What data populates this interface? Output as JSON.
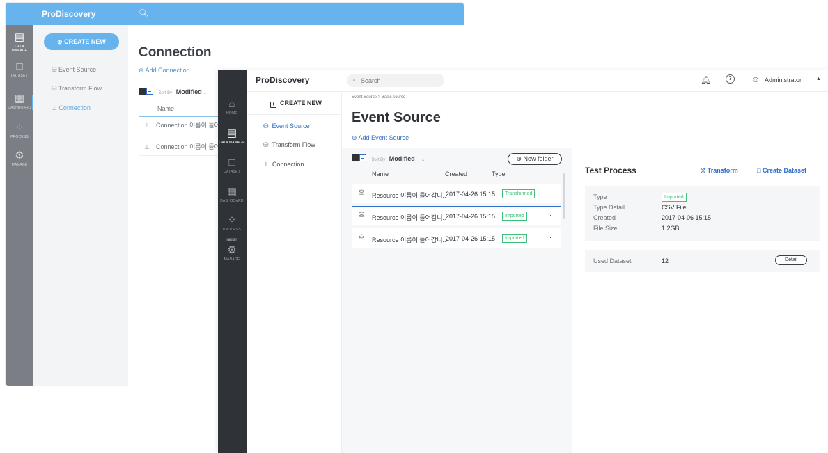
{
  "back_window": {
    "logo": "ProDiscovery",
    "rail": [
      {
        "label": "DATA\nMANAGE",
        "icon": "data-manage-icon"
      },
      {
        "label": "DATASET",
        "icon": "dataset-icon"
      },
      {
        "label": "DASHBOARD",
        "icon": "dashboard-icon"
      },
      {
        "label": "PROCESS",
        "icon": "process-icon"
      },
      {
        "label": "MANAGE",
        "icon": "gear-icon"
      }
    ],
    "create_new": "CREATE NEW",
    "menu": [
      "Event Source",
      "Transform Flow",
      "Connection"
    ],
    "title": "Connection",
    "add_link": "Add Connection",
    "sort_by_label": "Sort By",
    "sort_value": "Modified",
    "name_col": "Name",
    "rows": [
      "Connection 이름이 들어",
      "Connection 이름이 들어"
    ]
  },
  "front_window": {
    "logo": "ProDiscovery",
    "search_placeholder": "Search",
    "user": "Administrator",
    "rail": {
      "home": "HOME",
      "data_manage": "DATA MANAGE",
      "dataset": "DATASET",
      "dashboard": "DASHBOARD",
      "process": "PROCESS",
      "beta": "BETA",
      "manage": "MANAGE"
    },
    "create_new": "CREATE NEW",
    "menu": {
      "event_source": "Event Source",
      "transform_flow": "Transform Flow",
      "connection": "Connection"
    },
    "breadcrumb": "Event Source > Basic source",
    "title": "Event Source",
    "add_link": "Add Event Source",
    "sort_by_label": "Sort By",
    "sort_value": "Modified",
    "new_folder": "New folder",
    "columns": {
      "name": "Name",
      "created": "Created",
      "type": "Type"
    },
    "rows": [
      {
        "name": "Resource 이름이 들어갑니..",
        "created": "2017-04-26 15:15",
        "type": "Transformed",
        "more": "···"
      },
      {
        "name": "Resource 이름이 들어갑니..",
        "created": "2017-04-26 15:15",
        "type": "Imported",
        "more": "···"
      },
      {
        "name": "Resource 이름이 들어갑니..",
        "created": "2017-04-26 15:15",
        "type": "Imported",
        "more": "···"
      }
    ],
    "detail": {
      "title": "Test Process",
      "transform": "Transform",
      "create_dataset": "Create Dataset",
      "fields": {
        "type_label": "Type",
        "type_value": "Imported",
        "type_detail_label": "Type Detail",
        "type_detail_value": "CSV File",
        "created_label": "Created",
        "created_value": "2017-04-06 15:15",
        "file_size_label": "File Size",
        "file_size_value": "1.2GB"
      },
      "used_dataset_label": "Used Dataset",
      "used_dataset_value": "12",
      "detail_button": "Detail"
    }
  },
  "colors": {
    "accent_blue": "#2f6fc9",
    "back_topbar": "#67b3ee",
    "rail_dark": "#2f3237",
    "badge_green": "#3ebf7a"
  }
}
